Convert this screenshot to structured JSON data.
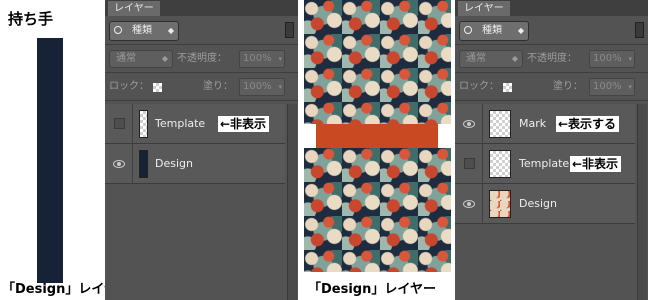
{
  "left": {
    "title": "持ち手",
    "caption": "「Design」レイヤー",
    "bar_color": "#172236"
  },
  "center": {
    "caption": "「Design」レイヤー",
    "band_color": "#c94a22"
  },
  "panels": {
    "tab_label": "レイヤー",
    "search_label": "種類",
    "blend_mode": "通常",
    "opacity_label": "不透明度：",
    "opacity_value": "100%",
    "lock_label": "ロック：",
    "fill_label": "塗り：",
    "fill_value": "100%"
  },
  "panel1": {
    "layers": [
      {
        "name": "Template",
        "visible": false,
        "note": "←非表示"
      },
      {
        "name": "Design",
        "visible": true
      }
    ]
  },
  "panel2": {
    "layers": [
      {
        "name": "Mark",
        "visible": true,
        "note": "←表示する"
      },
      {
        "name": "Template",
        "visible": false,
        "note": "←非表示"
      },
      {
        "name": "Design",
        "visible": true
      }
    ]
  },
  "icons": {
    "search": "search-icon",
    "eye": "eye-icon",
    "lock": "checker-lock-icon"
  }
}
